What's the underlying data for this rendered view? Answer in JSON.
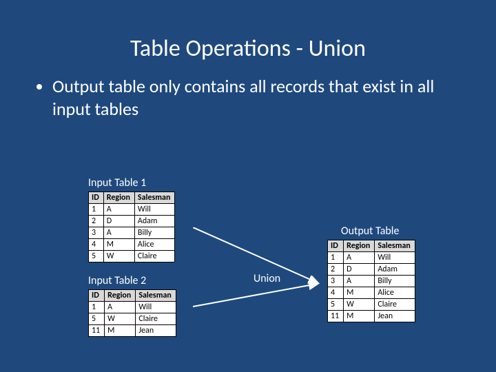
{
  "title": "Table Operations - Union",
  "bullet": "Output table only contains all records that exist in all input tables",
  "labels": {
    "input1": "Input Table 1",
    "input2": "Input Table 2",
    "output": "Output Table",
    "union": "Union"
  },
  "headers": {
    "id": "ID",
    "region": "Region",
    "salesman": "Salesman"
  },
  "input1": [
    {
      "id": "1",
      "region": "A",
      "salesman": "Will"
    },
    {
      "id": "2",
      "region": "D",
      "salesman": "Adam"
    },
    {
      "id": "3",
      "region": "A",
      "salesman": "Billy"
    },
    {
      "id": "4",
      "region": "M",
      "salesman": "Alice"
    },
    {
      "id": "5",
      "region": "W",
      "salesman": "Claire"
    }
  ],
  "input2": [
    {
      "id": "1",
      "region": "A",
      "salesman": "Will"
    },
    {
      "id": "5",
      "region": "W",
      "salesman": "Claire"
    },
    {
      "id": "11",
      "region": "M",
      "salesman": "Jean"
    }
  ],
  "output": [
    {
      "id": "1",
      "region": "A",
      "salesman": "Will"
    },
    {
      "id": "2",
      "region": "D",
      "salesman": "Adam"
    },
    {
      "id": "3",
      "region": "A",
      "salesman": "Billy"
    },
    {
      "id": "4",
      "region": "M",
      "salesman": "Alice"
    },
    {
      "id": "5",
      "region": "W",
      "salesman": "Claire"
    },
    {
      "id": "11",
      "region": "M",
      "salesman": "Jean"
    }
  ]
}
